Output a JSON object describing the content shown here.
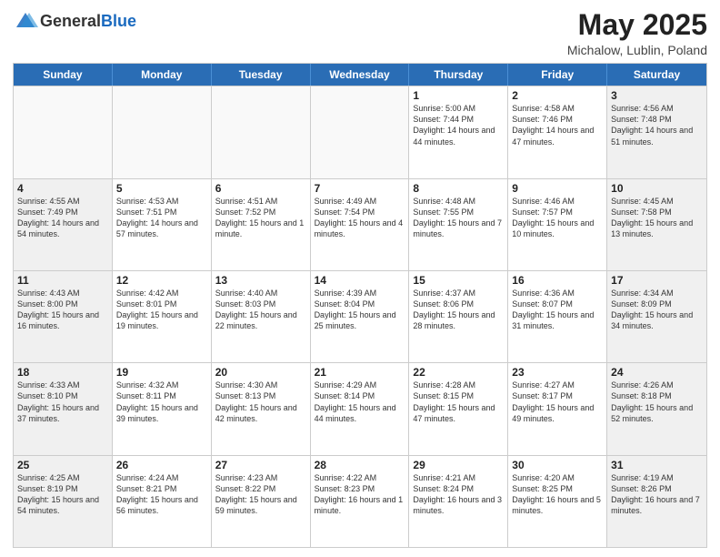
{
  "header": {
    "logo_line1": "General",
    "logo_line2": "Blue",
    "month_year": "May 2025",
    "location": "Michalow, Lublin, Poland"
  },
  "days_of_week": [
    "Sunday",
    "Monday",
    "Tuesday",
    "Wednesday",
    "Thursday",
    "Friday",
    "Saturday"
  ],
  "weeks": [
    [
      {
        "day": "",
        "info": "",
        "empty": true
      },
      {
        "day": "",
        "info": "",
        "empty": true
      },
      {
        "day": "",
        "info": "",
        "empty": true
      },
      {
        "day": "",
        "info": "",
        "empty": true
      },
      {
        "day": "1",
        "info": "Sunrise: 5:00 AM\nSunset: 7:44 PM\nDaylight: 14 hours\nand 44 minutes."
      },
      {
        "day": "2",
        "info": "Sunrise: 4:58 AM\nSunset: 7:46 PM\nDaylight: 14 hours\nand 47 minutes."
      },
      {
        "day": "3",
        "info": "Sunrise: 4:56 AM\nSunset: 7:48 PM\nDaylight: 14 hours\nand 51 minutes.",
        "shaded": true
      }
    ],
    [
      {
        "day": "4",
        "info": "Sunrise: 4:55 AM\nSunset: 7:49 PM\nDaylight: 14 hours\nand 54 minutes.",
        "shaded": true
      },
      {
        "day": "5",
        "info": "Sunrise: 4:53 AM\nSunset: 7:51 PM\nDaylight: 14 hours\nand 57 minutes."
      },
      {
        "day": "6",
        "info": "Sunrise: 4:51 AM\nSunset: 7:52 PM\nDaylight: 15 hours\nand 1 minute."
      },
      {
        "day": "7",
        "info": "Sunrise: 4:49 AM\nSunset: 7:54 PM\nDaylight: 15 hours\nand 4 minutes."
      },
      {
        "day": "8",
        "info": "Sunrise: 4:48 AM\nSunset: 7:55 PM\nDaylight: 15 hours\nand 7 minutes."
      },
      {
        "day": "9",
        "info": "Sunrise: 4:46 AM\nSunset: 7:57 PM\nDaylight: 15 hours\nand 10 minutes."
      },
      {
        "day": "10",
        "info": "Sunrise: 4:45 AM\nSunset: 7:58 PM\nDaylight: 15 hours\nand 13 minutes.",
        "shaded": true
      }
    ],
    [
      {
        "day": "11",
        "info": "Sunrise: 4:43 AM\nSunset: 8:00 PM\nDaylight: 15 hours\nand 16 minutes.",
        "shaded": true
      },
      {
        "day": "12",
        "info": "Sunrise: 4:42 AM\nSunset: 8:01 PM\nDaylight: 15 hours\nand 19 minutes."
      },
      {
        "day": "13",
        "info": "Sunrise: 4:40 AM\nSunset: 8:03 PM\nDaylight: 15 hours\nand 22 minutes."
      },
      {
        "day": "14",
        "info": "Sunrise: 4:39 AM\nSunset: 8:04 PM\nDaylight: 15 hours\nand 25 minutes."
      },
      {
        "day": "15",
        "info": "Sunrise: 4:37 AM\nSunset: 8:06 PM\nDaylight: 15 hours\nand 28 minutes."
      },
      {
        "day": "16",
        "info": "Sunrise: 4:36 AM\nSunset: 8:07 PM\nDaylight: 15 hours\nand 31 minutes."
      },
      {
        "day": "17",
        "info": "Sunrise: 4:34 AM\nSunset: 8:09 PM\nDaylight: 15 hours\nand 34 minutes.",
        "shaded": true
      }
    ],
    [
      {
        "day": "18",
        "info": "Sunrise: 4:33 AM\nSunset: 8:10 PM\nDaylight: 15 hours\nand 37 minutes.",
        "shaded": true
      },
      {
        "day": "19",
        "info": "Sunrise: 4:32 AM\nSunset: 8:11 PM\nDaylight: 15 hours\nand 39 minutes."
      },
      {
        "day": "20",
        "info": "Sunrise: 4:30 AM\nSunset: 8:13 PM\nDaylight: 15 hours\nand 42 minutes."
      },
      {
        "day": "21",
        "info": "Sunrise: 4:29 AM\nSunset: 8:14 PM\nDaylight: 15 hours\nand 44 minutes."
      },
      {
        "day": "22",
        "info": "Sunrise: 4:28 AM\nSunset: 8:15 PM\nDaylight: 15 hours\nand 47 minutes."
      },
      {
        "day": "23",
        "info": "Sunrise: 4:27 AM\nSunset: 8:17 PM\nDaylight: 15 hours\nand 49 minutes."
      },
      {
        "day": "24",
        "info": "Sunrise: 4:26 AM\nSunset: 8:18 PM\nDaylight: 15 hours\nand 52 minutes.",
        "shaded": true
      }
    ],
    [
      {
        "day": "25",
        "info": "Sunrise: 4:25 AM\nSunset: 8:19 PM\nDaylight: 15 hours\nand 54 minutes.",
        "shaded": true
      },
      {
        "day": "26",
        "info": "Sunrise: 4:24 AM\nSunset: 8:21 PM\nDaylight: 15 hours\nand 56 minutes."
      },
      {
        "day": "27",
        "info": "Sunrise: 4:23 AM\nSunset: 8:22 PM\nDaylight: 15 hours\nand 59 minutes."
      },
      {
        "day": "28",
        "info": "Sunrise: 4:22 AM\nSunset: 8:23 PM\nDaylight: 16 hours\nand 1 minute."
      },
      {
        "day": "29",
        "info": "Sunrise: 4:21 AM\nSunset: 8:24 PM\nDaylight: 16 hours\nand 3 minutes."
      },
      {
        "day": "30",
        "info": "Sunrise: 4:20 AM\nSunset: 8:25 PM\nDaylight: 16 hours\nand 5 minutes."
      },
      {
        "day": "31",
        "info": "Sunrise: 4:19 AM\nSunset: 8:26 PM\nDaylight: 16 hours\nand 7 minutes.",
        "shaded": true
      }
    ]
  ]
}
